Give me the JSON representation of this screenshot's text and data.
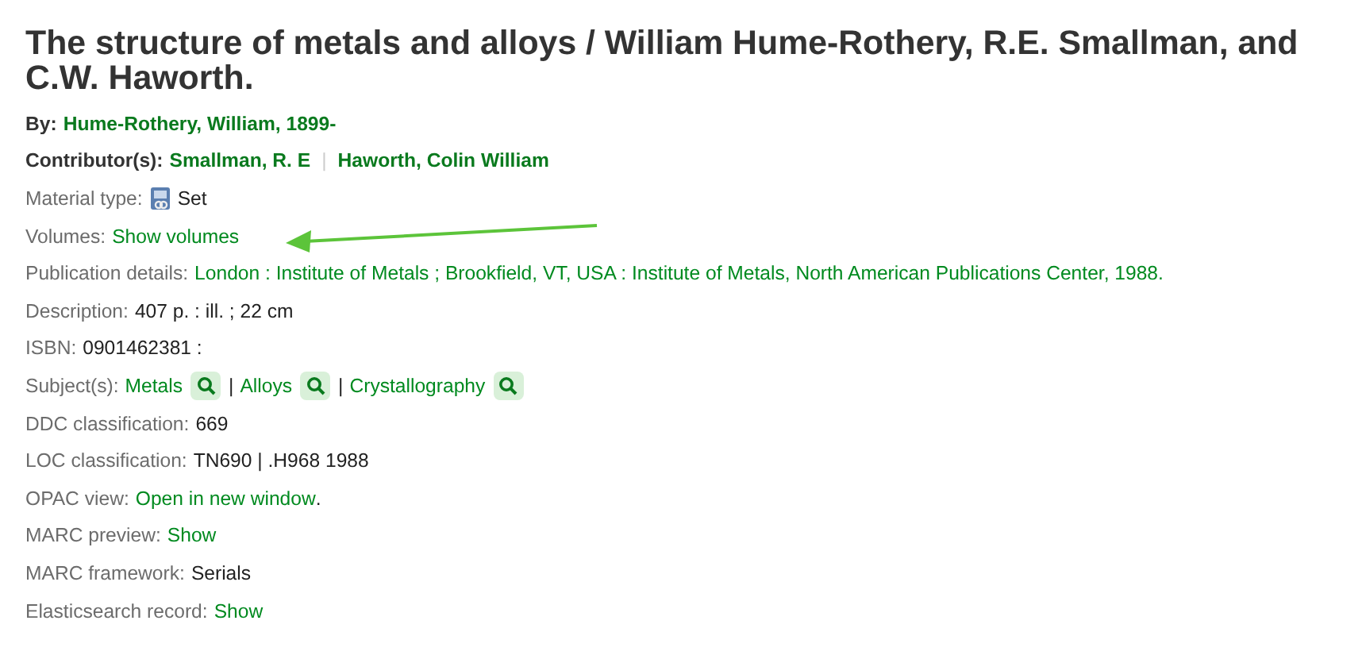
{
  "title": "The structure of metals and alloys / William Hume-Rothery, R.E. Smallman, and C.W. Haworth.",
  "fields": [
    {
      "label": "By:",
      "bold": true,
      "parts": [
        {
          "kind": "link",
          "text": "Hume-Rothery, William, 1899-"
        }
      ]
    },
    {
      "label": "Contributor(s):",
      "bold": true,
      "parts": [
        {
          "kind": "link",
          "text": "Smallman, R. E"
        },
        {
          "kind": "sep",
          "text": "|"
        },
        {
          "kind": "link",
          "text": "Haworth, Colin William"
        }
      ]
    },
    {
      "label": "Material type:",
      "bold": false,
      "parts": [
        {
          "kind": "material"
        },
        {
          "kind": "text",
          "text": "Set"
        }
      ]
    },
    {
      "label": "Volumes:",
      "bold": false,
      "parts": [
        {
          "kind": "link",
          "text": "Show volumes"
        }
      ]
    },
    {
      "label": "Publication details:",
      "bold": false,
      "parts": [
        {
          "kind": "link",
          "text": "London : Institute of Metals ; Brookfield, VT, USA : Institute of Metals, North American Publications Center, 1988."
        }
      ]
    },
    {
      "label": "Description:",
      "bold": false,
      "parts": [
        {
          "kind": "text",
          "text": "407 p. : ill. ; 22 cm"
        }
      ]
    },
    {
      "label": "ISBN:",
      "bold": false,
      "parts": [
        {
          "kind": "text",
          "text": "0901462381 :"
        }
      ]
    },
    {
      "label": "Subject(s):",
      "bold": false,
      "parts": [
        {
          "kind": "link",
          "text": "Metals"
        },
        {
          "kind": "search"
        },
        {
          "kind": "text",
          "text": "|"
        },
        {
          "kind": "link",
          "text": "Alloys"
        },
        {
          "kind": "search"
        },
        {
          "kind": "text",
          "text": "|"
        },
        {
          "kind": "link",
          "text": "Crystallography"
        },
        {
          "kind": "search"
        }
      ]
    },
    {
      "label": "DDC classification:",
      "bold": false,
      "parts": [
        {
          "kind": "text",
          "text": "669"
        }
      ]
    },
    {
      "label": "LOC classification:",
      "bold": false,
      "parts": [
        {
          "kind": "text",
          "text": "TN690 | .H968 1988"
        }
      ]
    },
    {
      "label": "OPAC view:",
      "bold": false,
      "parts": [
        {
          "kind": "link",
          "text": "Open in new window"
        },
        {
          "kind": "punct",
          "text": "."
        }
      ]
    },
    {
      "label": "MARC preview:",
      "bold": false,
      "parts": [
        {
          "kind": "link",
          "text": "Show"
        }
      ]
    },
    {
      "label": "MARC framework:",
      "bold": false,
      "parts": [
        {
          "kind": "text",
          "text": "Serials"
        }
      ]
    },
    {
      "label": "Elasticsearch record:",
      "bold": false,
      "parts": [
        {
          "kind": "link",
          "text": "Show"
        }
      ]
    }
  ]
}
